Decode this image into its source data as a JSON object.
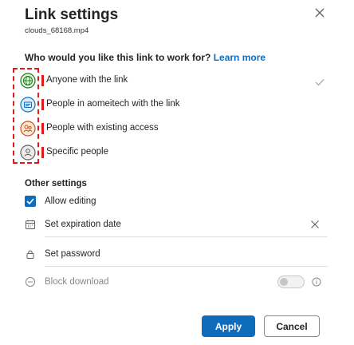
{
  "dialog": {
    "title": "Link settings",
    "filename": "clouds_68168.mp4",
    "question": "Who would you like this link to work for?",
    "learn_more": "Learn more",
    "accent_color": "#0f6cbd",
    "highlight_color": "#e0191d"
  },
  "link_options": [
    {
      "label": "Anyone with the link",
      "icon": "globe-icon",
      "selected": true
    },
    {
      "label": "People in aomeitech with the link",
      "icon": "building-icon",
      "selected": false
    },
    {
      "label": "People with existing access",
      "icon": "people-icon",
      "selected": false
    },
    {
      "label": "Specific people",
      "icon": "person-icon",
      "selected": false
    }
  ],
  "other_settings": {
    "heading": "Other settings",
    "allow_editing": {
      "label": "Allow editing",
      "checked": true
    },
    "expiration": {
      "label": "Set expiration date",
      "icon": "calendar-icon"
    },
    "password": {
      "label": "Set password",
      "icon": "lock-icon"
    },
    "block_download": {
      "label": "Block download",
      "icon": "block-icon",
      "enabled": false,
      "toggle_on": false
    }
  },
  "buttons": {
    "apply": "Apply",
    "cancel": "Cancel"
  }
}
